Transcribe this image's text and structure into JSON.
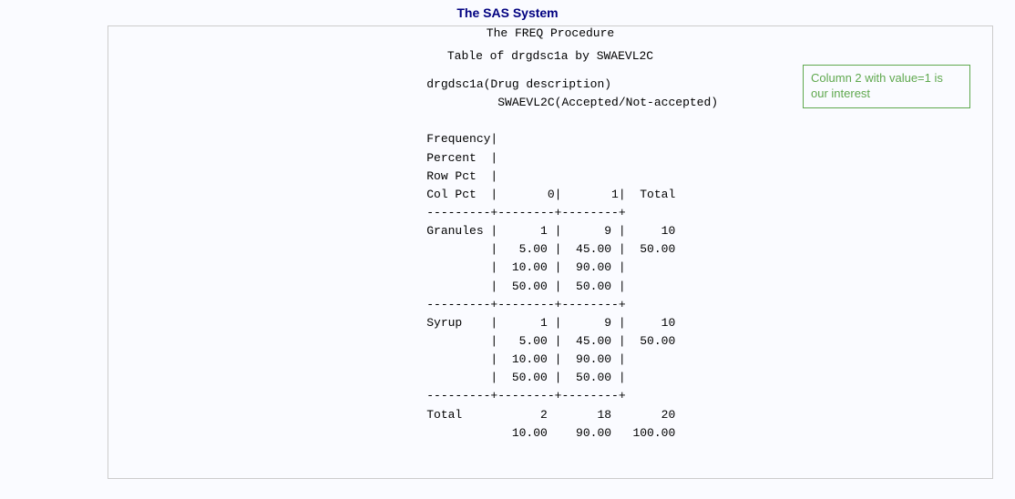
{
  "page_title": "The SAS System",
  "proc_title": "The FREQ Procedure",
  "table_title": "Table of drgdsc1a by SWAEVL2C",
  "annotation_text": "Column 2 with value=1 is our interest",
  "freq_body": "              drgdsc1a(Drug description)\n                        SWAEVL2C(Accepted/Not-accepted)\n\n              Frequency|\n              Percent  |\n              Row Pct  |\n              Col Pct  |       0|       1|  Total\n              ---------+--------+--------+\n              Granules |      1 |      9 |     10\n                       |   5.00 |  45.00 |  50.00\n                       |  10.00 |  90.00 |\n                       |  50.00 |  50.00 |\n              ---------+--------+--------+\n              Syrup    |      1 |      9 |     10\n                       |   5.00 |  45.00 |  50.00\n                       |  10.00 |  90.00 |\n                       |  50.00 |  50.00 |\n              ---------+--------+--------+\n              Total           2       18       20\n                          10.00    90.00   100.00",
  "chart_data": {
    "type": "table",
    "title": "Table of drgdsc1a by SWAEVL2C",
    "row_var": "drgdsc1a",
    "row_var_label": "Drug description",
    "col_var": "SWAEVL2C",
    "col_var_label": "Accepted/Not-accepted",
    "stat_labels": [
      "Frequency",
      "Percent",
      "Row Pct",
      "Col Pct"
    ],
    "col_levels": [
      "0",
      "1"
    ],
    "rows": [
      {
        "label": "Granules",
        "cells": [
          {
            "level": "0",
            "frequency": 1,
            "percent": 5.0,
            "row_pct": 10.0,
            "col_pct": 50.0
          },
          {
            "level": "1",
            "frequency": 9,
            "percent": 45.0,
            "row_pct": 90.0,
            "col_pct": 50.0
          }
        ],
        "total": {
          "frequency": 10,
          "percent": 50.0
        }
      },
      {
        "label": "Syrup",
        "cells": [
          {
            "level": "0",
            "frequency": 1,
            "percent": 5.0,
            "row_pct": 10.0,
            "col_pct": 50.0
          },
          {
            "level": "1",
            "frequency": 9,
            "percent": 45.0,
            "row_pct": 90.0,
            "col_pct": 50.0
          }
        ],
        "total": {
          "frequency": 10,
          "percent": 50.0
        }
      }
    ],
    "col_totals": [
      {
        "level": "0",
        "frequency": 2,
        "percent": 10.0
      },
      {
        "level": "1",
        "frequency": 18,
        "percent": 90.0
      }
    ],
    "grand_total": {
      "frequency": 20,
      "percent": 100.0
    }
  }
}
